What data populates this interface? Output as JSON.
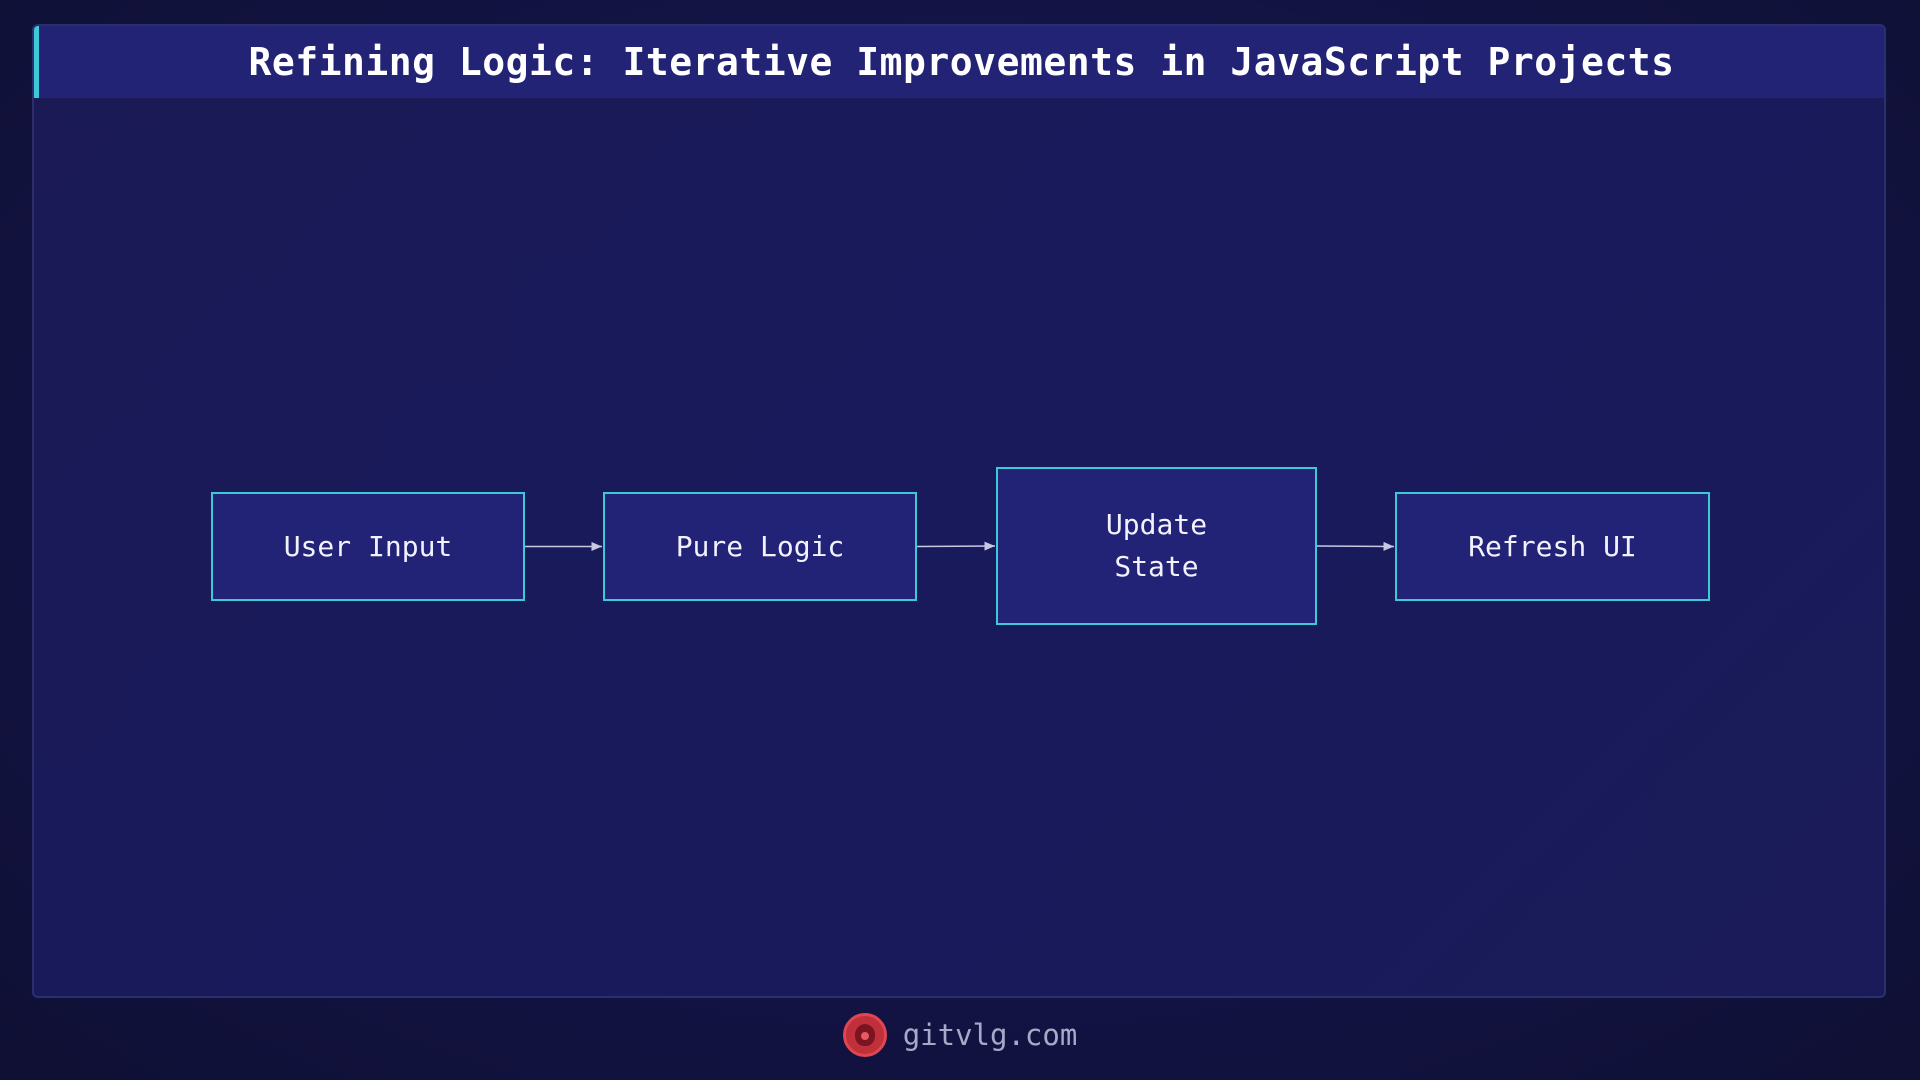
{
  "title": "Refining Logic: Iterative Improvements in JavaScript Projects",
  "nodes": [
    {
      "id": "user-input",
      "lines": [
        "User Input"
      ]
    },
    {
      "id": "pure-logic",
      "lines": [
        "Pure Logic"
      ]
    },
    {
      "id": "update-state",
      "lines": [
        "Update",
        "State"
      ]
    },
    {
      "id": "refresh-ui",
      "lines": [
        "Refresh UI"
      ]
    }
  ],
  "edges": [
    {
      "from": "user-input",
      "to": "pure-logic"
    },
    {
      "from": "pure-logic",
      "to": "update-state"
    },
    {
      "from": "update-state",
      "to": "refresh-ui"
    }
  ],
  "colors": {
    "node_border": "#3ec9d6",
    "node_fill": "#222276",
    "edge": "#c8c8e0",
    "accent": "#3ec9d6"
  },
  "footer": {
    "logo_icon": "lion-logo-icon",
    "site": "gitvlg.com"
  }
}
